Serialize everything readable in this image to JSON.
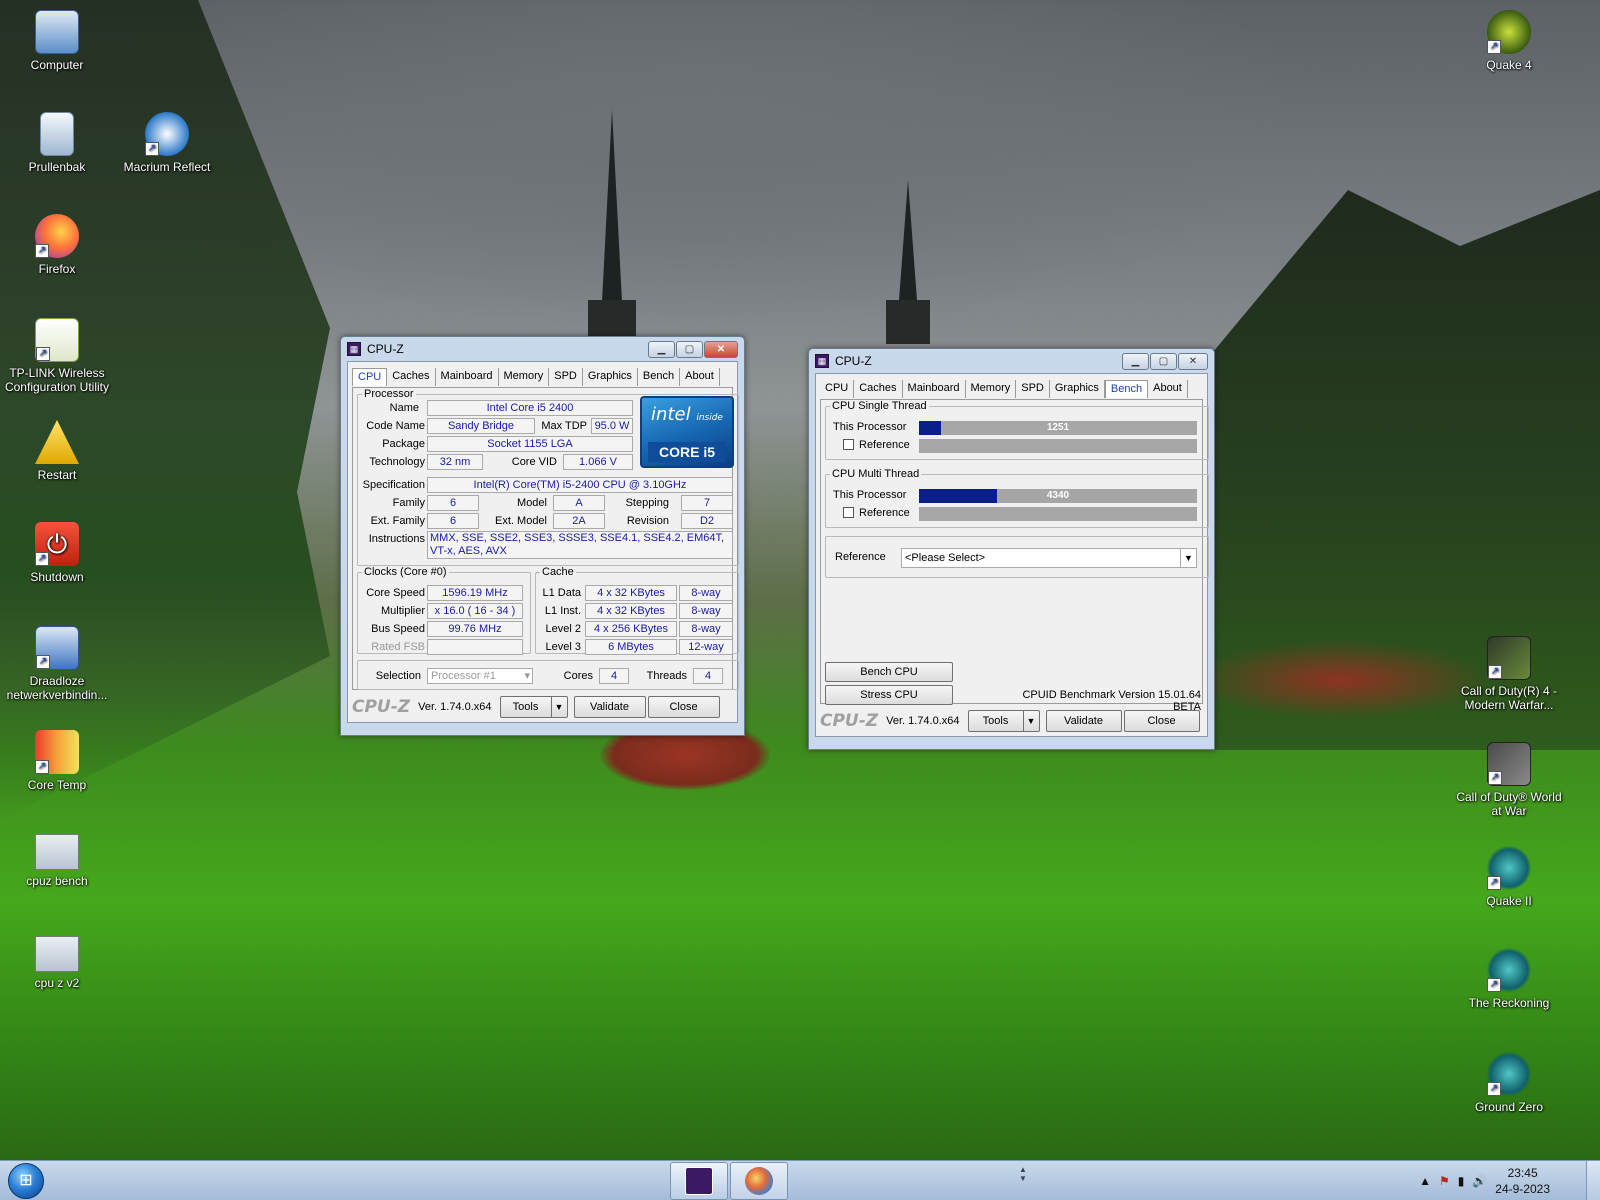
{
  "desktop": {
    "icons_left": [
      {
        "label": "Computer"
      },
      {
        "label": "Prullenbak"
      },
      {
        "label": "Macrium Reflect"
      },
      {
        "label": "Firefox"
      },
      {
        "label": "TP-LINK Wireless Configuration Utility"
      },
      {
        "label": "Restart"
      },
      {
        "label": "Shutdown"
      },
      {
        "label": "Draadloze netwerkverbindin..."
      },
      {
        "label": "Core Temp"
      },
      {
        "label": "cpuz bench"
      },
      {
        "label": "cpu z v2"
      }
    ],
    "icons_right": [
      {
        "label": "Quake 4"
      },
      {
        "label": "Call of Duty(R) 4 - Modern Warfar..."
      },
      {
        "label": "Call of Duty® World at War"
      },
      {
        "label": "Quake II"
      },
      {
        "label": "The Reckoning"
      },
      {
        "label": "Ground Zero"
      }
    ]
  },
  "window1": {
    "title": "CPU-Z",
    "tabs": [
      "CPU",
      "Caches",
      "Mainboard",
      "Memory",
      "SPD",
      "Graphics",
      "Bench",
      "About"
    ],
    "processor": {
      "legend": "Processor",
      "name_label": "Name",
      "name": "Intel Core i5 2400",
      "codename_label": "Code Name",
      "codename": "Sandy Bridge",
      "maxtdp_label": "Max TDP",
      "maxtdp": "95.0 W",
      "package_label": "Package",
      "package": "Socket 1155 LGA",
      "technology_label": "Technology",
      "technology": "32 nm",
      "corevid_label": "Core VID",
      "corevid": "1.066 V",
      "spec_label": "Specification",
      "spec": "Intel(R) Core(TM) i5-2400 CPU @ 3.10GHz",
      "family_label": "Family",
      "family": "6",
      "model_label": "Model",
      "model": "A",
      "stepping_label": "Stepping",
      "stepping": "7",
      "extfamily_label": "Ext. Family",
      "extfamily": "6",
      "extmodel_label": "Ext. Model",
      "extmodel": "2A",
      "revision_label": "Revision",
      "revision": "D2",
      "instructions_label": "Instructions",
      "instructions": "MMX, SSE, SSE2, SSE3, SSSE3, SSE4.1, SSE4.2, EM64T, VT-x, AES, AVX",
      "badge_top": "intel",
      "badge_inside": "inside",
      "badge_bottom": "CORE i5"
    },
    "clocks": {
      "legend": "Clocks (Core #0)",
      "corespeed_label": "Core Speed",
      "corespeed": "1596.19 MHz",
      "multiplier_label": "Multiplier",
      "multiplier": "x 16.0 ( 16 - 34 )",
      "busspeed_label": "Bus Speed",
      "busspeed": "99.76 MHz",
      "ratedfsb_label": "Rated FSB",
      "ratedfsb": ""
    },
    "cache": {
      "legend": "Cache",
      "rows": [
        {
          "label": "L1 Data",
          "size": "4 x 32 KBytes",
          "way": "8-way"
        },
        {
          "label": "L1 Inst.",
          "size": "4 x 32 KBytes",
          "way": "8-way"
        },
        {
          "label": "Level 2",
          "size": "4 x 256 KBytes",
          "way": "8-way"
        },
        {
          "label": "Level 3",
          "size": "6 MBytes",
          "way": "12-way"
        }
      ]
    },
    "selection_label": "Selection",
    "selection": "Processor #1",
    "cores_label": "Cores",
    "cores": "4",
    "threads_label": "Threads",
    "threads": "4",
    "brand": "CPU-Z",
    "version": "Ver. 1.74.0.x64",
    "tools_label": "Tools",
    "validate_label": "Validate",
    "close_label": "Close"
  },
  "window2": {
    "title": "CPU-Z",
    "tabs": [
      "CPU",
      "Caches",
      "Mainboard",
      "Memory",
      "SPD",
      "Graphics",
      "Bench",
      "About"
    ],
    "single": {
      "legend": "CPU Single Thread",
      "this_label": "This Processor",
      "score": "1251",
      "score_fraction": 0.08,
      "ref_label": "Reference"
    },
    "multi": {
      "legend": "CPU Multi Thread",
      "this_label": "This Processor",
      "score": "4340",
      "score_fraction": 0.28,
      "ref_label": "Reference"
    },
    "reference_label": "Reference",
    "reference_value": "<Please Select>",
    "bench_cpu_label": "Bench CPU",
    "stress_cpu_label": "Stress CPU",
    "bench_version": "CPUID Benchmark Version 15.01.64 BETA",
    "brand": "CPU-Z",
    "version": "Ver. 1.74.0.x64",
    "tools_label": "Tools",
    "validate_label": "Validate",
    "close_label": "Close"
  },
  "taskbar": {
    "time": "23:45",
    "date": "24-9-2023"
  },
  "colors": {
    "tab_active": "#1c3fb0",
    "value_text": "#1a1aa6",
    "bench_fill": "#0a1f8a"
  }
}
